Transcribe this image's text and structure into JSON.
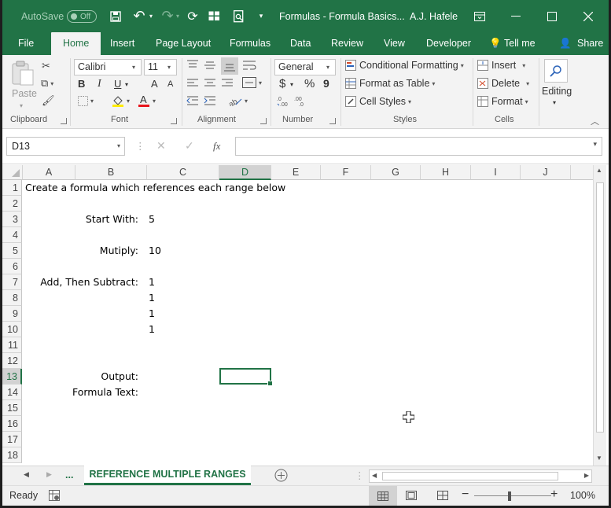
{
  "titlebar": {
    "autosave_label": "AutoSave",
    "autosave_state": "Off",
    "doc_title": "Formulas - Formula Basics...",
    "user": "A.J. Hafele"
  },
  "tabs": [
    "File",
    "Home",
    "Insert",
    "Page Layout",
    "Formulas",
    "Data",
    "Review",
    "View",
    "Developer",
    "Tell me",
    "Share"
  ],
  "ribbon": {
    "clipboard": {
      "paste": "Paste",
      "label": "Clipboard"
    },
    "font": {
      "name": "Calibri",
      "size": "11",
      "label": "Font",
      "bold": "B",
      "italic": "I",
      "underline": "U",
      "grow": "A",
      "shrink": "A"
    },
    "alignment": {
      "label": "Alignment"
    },
    "number": {
      "format": "General",
      "label": "Number",
      "currency": "$",
      "percent": "%",
      "comma": "9"
    },
    "styles": {
      "conditional": "Conditional Formatting",
      "table": "Format as Table",
      "cell_styles": "Cell Styles",
      "label": "Styles"
    },
    "cells": {
      "insert": "Insert",
      "delete": "Delete",
      "format": "Format",
      "label": "Cells"
    },
    "editing": {
      "label": "Editing"
    }
  },
  "formula_bar": {
    "name_box": "D13",
    "fx": "fx",
    "content": ""
  },
  "columns": [
    "A",
    "B",
    "C",
    "D",
    "E",
    "F",
    "G",
    "H",
    "I",
    "J"
  ],
  "rows": [
    "1",
    "2",
    "3",
    "4",
    "5",
    "6",
    "7",
    "8",
    "9",
    "10",
    "11",
    "12",
    "13",
    "14",
    "15",
    "16",
    "17",
    "18"
  ],
  "selection": {
    "column": "D",
    "row": "13"
  },
  "cells": {
    "A1": "Create a formula which references each range below",
    "B3": "Start With:",
    "C3": "5",
    "B5": "Mutiply:",
    "C5": "10",
    "B7": "Add, Then Subtract:",
    "C7": "1",
    "C8": "1",
    "C9": "1",
    "C10": "1",
    "B13": "Output:",
    "B14": "Formula Text:"
  },
  "sheet_tabs": {
    "ellipsis": "...",
    "active": "REFERENCE MULTIPLE RANGES"
  },
  "status": {
    "state": "Ready",
    "zoom": "100%"
  },
  "colors": {
    "brand": "#217346"
  }
}
